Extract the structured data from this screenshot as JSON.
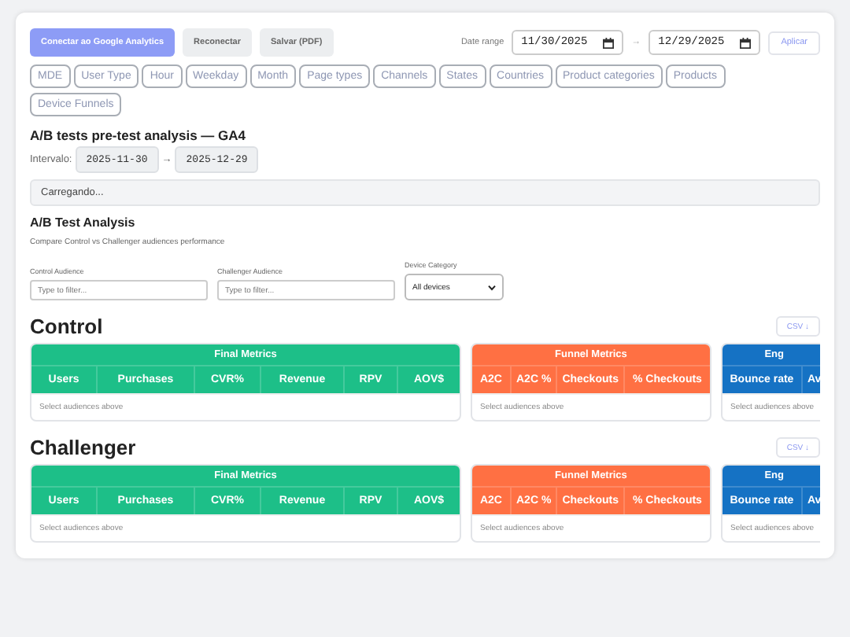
{
  "toolbar": {
    "buttons": [
      {
        "label": "Conectar ao Google Analytics",
        "kind": "primary"
      },
      {
        "label": "Reconectar",
        "kind": "secondary"
      },
      {
        "label": "Salvar (PDF)",
        "kind": "secondary"
      }
    ],
    "date_range": {
      "label": "Date range",
      "start": "11/30/2025",
      "separator": "→",
      "end": "12/29/2025",
      "apply": "Aplicar"
    }
  },
  "tabs": [
    {
      "label": "MDE",
      "disabled": true,
      "selected": false
    },
    {
      "label": "User Type",
      "disabled": true,
      "selected": false
    },
    {
      "label": "Hour",
      "disabled": true,
      "selected": false
    },
    {
      "label": "Weekday",
      "disabled": true,
      "selected": false
    },
    {
      "label": "Month",
      "disabled": true,
      "selected": false
    },
    {
      "label": "Page types",
      "disabled": true,
      "selected": false
    },
    {
      "label": "Channels",
      "disabled": true,
      "selected": false
    },
    {
      "label": "States",
      "disabled": true,
      "selected": false
    },
    {
      "label": "Countries",
      "disabled": true,
      "selected": false
    },
    {
      "label": "Product categories",
      "disabled": true,
      "selected": false
    },
    {
      "label": "Products",
      "disabled": true,
      "selected": false
    },
    {
      "label": "Device Funnels",
      "disabled": true,
      "selected": false
    }
  ],
  "header": {
    "title": "A/B tests pre-test analysis — GA4",
    "interval_label": "Intervalo:",
    "start": "2025-11-30",
    "arrow": "→",
    "end": "2025-12-29"
  },
  "status": "Carregando...",
  "analysis": {
    "title": "A/B Test Analysis",
    "subtitle": "Compare Control vs Challenger audiences performance",
    "filters": [
      {
        "label": "Control Audience",
        "kind": "text",
        "placeholder": "Type to filter..."
      },
      {
        "label": "Challenger Audience",
        "kind": "text",
        "placeholder": "Type to filter..."
      },
      {
        "label": "Device Category",
        "kind": "select",
        "value": "All devices"
      }
    ]
  },
  "sections": [
    {
      "title": "Control",
      "csv": "CSV ↓",
      "groups": [
        {
          "title": "Final Metrics",
          "color": "#1dbf88",
          "columns": [
            "Users",
            "Purchases",
            "CVR%",
            "Revenue",
            "RPV",
            "AOV$"
          ],
          "empty": "Select audiences above"
        },
        {
          "title": "Funnel Metrics",
          "color": "#ff7043",
          "columns": [
            "A2C",
            "A2C %",
            "Checkouts",
            "% Checkouts"
          ],
          "empty": "Select audiences above"
        },
        {
          "title": "Eng",
          "color": "#1572c4",
          "columns": [
            "Bounce rate",
            "Av"
          ],
          "empty": "Select audiences above"
        }
      ]
    },
    {
      "title": "Challenger",
      "csv": "CSV ↓",
      "groups": [
        {
          "title": "Final Metrics",
          "color": "#1dbf88",
          "columns": [
            "Users",
            "Purchases",
            "CVR%",
            "Revenue",
            "RPV",
            "AOV$"
          ],
          "empty": "Select audiences above"
        },
        {
          "title": "Funnel Metrics",
          "color": "#ff7043",
          "columns": [
            "A2C",
            "A2C %",
            "Checkouts",
            "% Checkouts"
          ],
          "empty": "Select audiences above"
        },
        {
          "title": "Eng",
          "color": "#1572c4",
          "columns": [
            "Bounce rate",
            "Av"
          ],
          "empty": "Select audiences above"
        }
      ]
    }
  ]
}
